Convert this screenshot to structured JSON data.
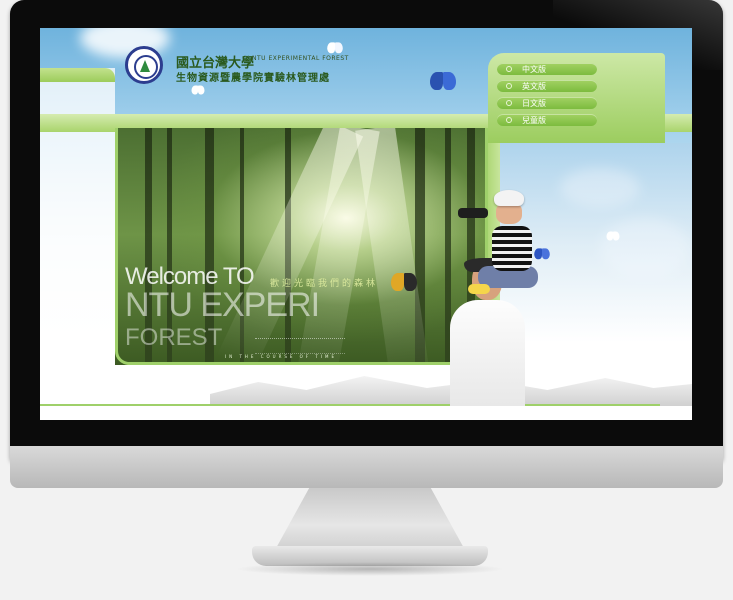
{
  "site": {
    "logo_name": "NTU emblem",
    "title_cn": "國立台灣大學",
    "title_en": "NTU EXPERIMENTAL FOREST",
    "subtitle_cn": "生物資源暨農學院實驗林管理處"
  },
  "languages": [
    {
      "label": "中文版"
    },
    {
      "label": "英文版"
    },
    {
      "label": "日文版"
    },
    {
      "label": "兒童版"
    }
  ],
  "hero": {
    "welcome": "Welcome TO",
    "line2": "NTU EXPERI",
    "line3": "FOREST",
    "slogan": "歡迎光臨我們的森林",
    "tagline": "IN THE COURSE OF TIME"
  },
  "colors": {
    "accent_green": "#9fd06a",
    "dark_green": "#2a5a1e",
    "sky_blue": "#6fb3dd",
    "bezel": "#0b0b0b"
  }
}
